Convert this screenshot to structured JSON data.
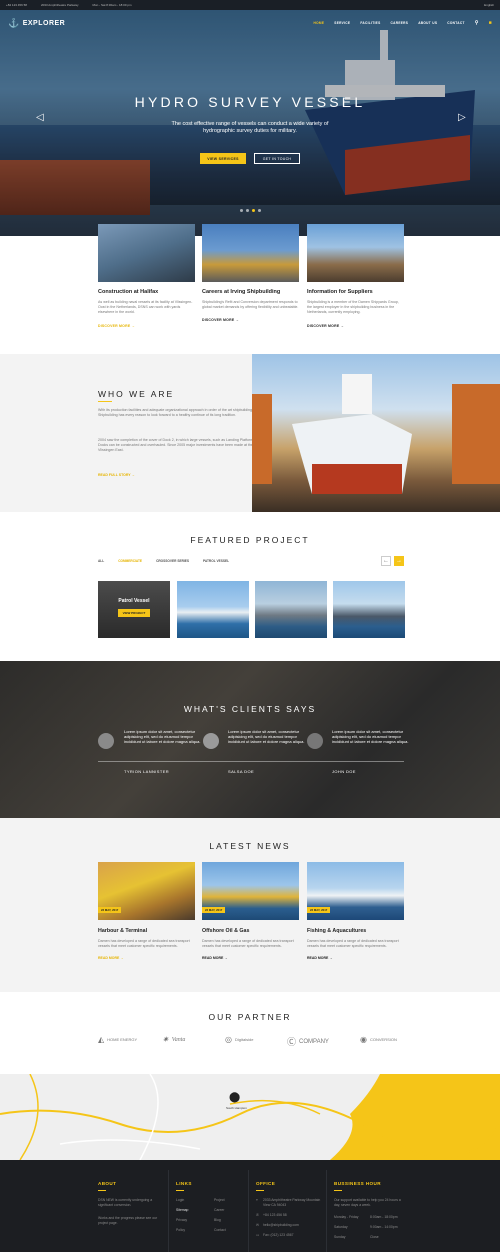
{
  "topbar": {
    "phone": "+84 123 456 58",
    "address": "2033 Amphitheatre Parkway",
    "hours": "Mon - Sat 8:30am - 18:00 pm",
    "language": "English"
  },
  "brand": {
    "name": "EXPLORER"
  },
  "nav": {
    "items": [
      "HOME",
      "SERVICE",
      "FACILITIES",
      "CAREERS",
      "ABOUT US",
      "CONTACT"
    ]
  },
  "hero": {
    "title": "HYDRO SURVEY VESSEL",
    "subtitle": "The cost effective range of vessels can conduct a wide variety of hydrographic survey duties for military.",
    "btn_primary": "VIEW SERVICES",
    "btn_secondary": "GET IN TOUCH",
    "slides": 4,
    "active_slide": 2
  },
  "services": [
    {
      "title": "Construction at Halifax",
      "text": "As well as building naval vessels at its facility at Vlissingen-Oost in the Netherlands, DSNS can work with yards elsewhere in the world.",
      "more": "DISCOVER MORE"
    },
    {
      "title": "Careers at Irving Shipbuilding",
      "text": "Shipbuilding's Refit and Conversion department responds to global market demands by offering flexibility and unbeatable.",
      "more": "DISCOVER MORE"
    },
    {
      "title": "Information for Suppliers",
      "text": "Shipbuilding is a member of the Damen Shipyards Group, the largest employer in the shipbuilding business in the Netherlands, currently employing.",
      "more": "DISCOVER MORE"
    }
  ],
  "who": {
    "title": "WHO WE ARE",
    "p1": "With its production facilities and adequate organizational approach in order of the art shipbuilding. Shipbuilding has every reason to look forward to a healthy continue of its long tradition.",
    "p2": "2004 saw the completion of the cover of Dock 2, in which large vessels, such as Landing Platform Docks can be constructed and overhauled. Since 2005 major investments have been made at the Vlissingen East.",
    "more": "READ FULL STORY"
  },
  "featured": {
    "title": "FEATURED PROJECT",
    "filters": [
      "ALL",
      "COMMERCIATE",
      "CROSSOVER SERIES",
      "PATROL VESSEL"
    ],
    "card_title": "Patrol Vessel",
    "card_btn": "VIEW PROJECT"
  },
  "testimonials": {
    "title": "WHAT'S CLIENTS SAYS",
    "items": [
      {
        "quote": "Lorem ipsum dolor sit amet, consectetur adipisicing elit, sed do eiusmod tempor incididunt ut labore et dolore magna aliqua.",
        "name": "TYRION LANNISTER"
      },
      {
        "quote": "Lorem ipsum dolor sit amet, consectetur adipisicing elit, sed do eiusmod tempor incididunt ut labore et dolore magna aliqua.",
        "name": "SALSA DOE"
      },
      {
        "quote": "Lorem ipsum dolor sit amet, consectetur adipisicing elit, sed do eiusmod tempor incididunt ut labore et dolore magna aliqua.",
        "name": "JOHN DOE"
      }
    ]
  },
  "news": {
    "title": "LATEST NEWS",
    "items": [
      {
        "title": "Harbour & Terminal",
        "date": "23 MAY, 2017",
        "text": "Damen has developed a range of dedicated sea transport vessels that meet customer specific requirements.",
        "more": "READ MORE"
      },
      {
        "title": "Offshore Oil & Gas",
        "date": "23 MAY, 2017",
        "text": "Damen has developed a range of dedicated sea transport vessels that meet customer specific requirements.",
        "more": "READ MORE"
      },
      {
        "title": "Fishing & Aquacultures",
        "date": "23 MAY, 2017",
        "text": "Damen has developed a range of dedicated sea transport vessels that meet customer specific requirements.",
        "more": "READ MORE"
      }
    ]
  },
  "partners": {
    "title": "OUR PARTNER",
    "items": [
      "HOME ENERGY",
      "Vanta",
      "Digitalside",
      "COMPANY",
      "CONVERSION"
    ]
  },
  "map": {
    "pin_label": "South Hampton"
  },
  "footer": {
    "about": {
      "title": "ABOUT",
      "text": "DSN NEW is currently undergoing a significant conversion.",
      "text2": "Works and the progress please see our project page."
    },
    "links": {
      "title": "LINKS",
      "col1": [
        "Login",
        "Sitemap",
        "Privacy",
        "Policy"
      ],
      "col2": [
        "Project",
        "Career",
        "Blog",
        "Contact"
      ]
    },
    "office": {
      "title": "OFFICE",
      "address": "2033 Amphitheatre Parkway Mountain View CA 94043",
      "phone": "+84 123 456 58",
      "email": "hello@shipbuilding.com",
      "fax": "Fax: (012) 123 4567"
    },
    "hours": {
      "title": "BUSSINESS HOUR",
      "text": "Our support available to help you 24 hours a day, seven days a week.",
      "rows": [
        [
          "Monday - Friday",
          "8:00am - 18:00pm"
        ],
        [
          "Saturday",
          "9:00am - 14:00pm"
        ],
        [
          "Sunday",
          "Close"
        ]
      ]
    }
  },
  "colors": {
    "accent": "#f5c518",
    "dark": "#1c1e22"
  }
}
